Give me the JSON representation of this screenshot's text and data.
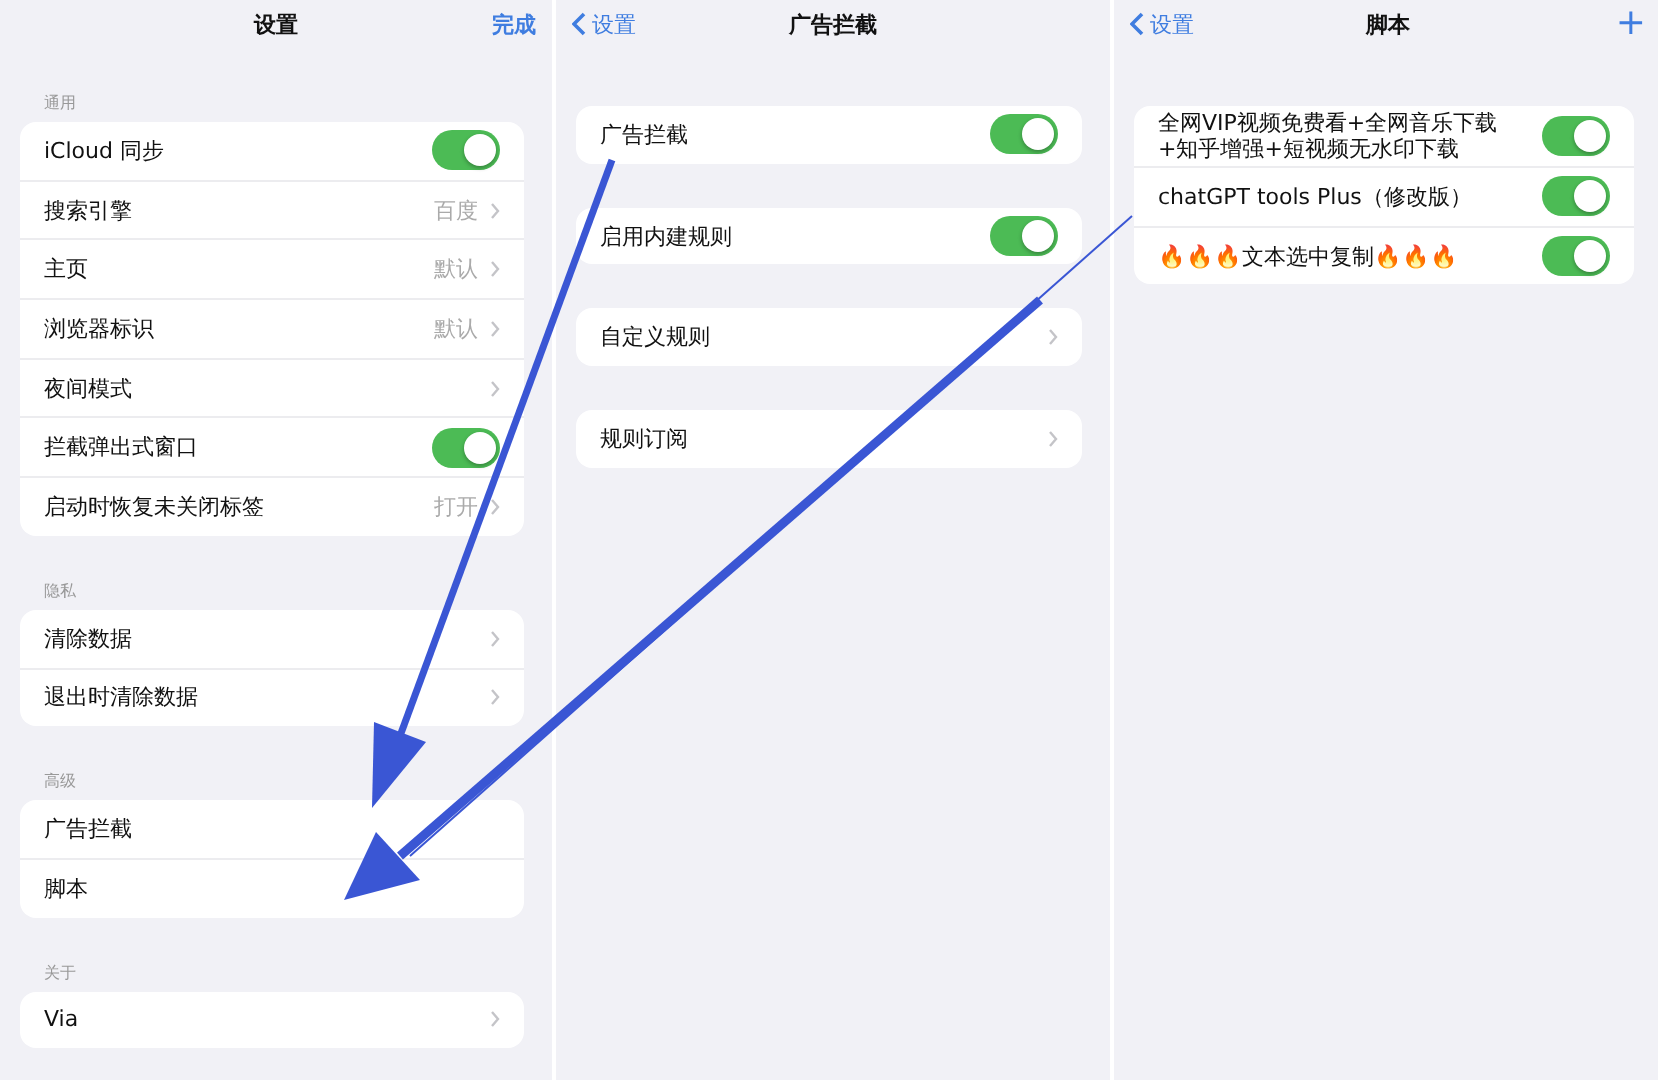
{
  "panels": [
    {
      "title": "设置",
      "done": "完成",
      "sections": [
        {
          "header": "通用",
          "grouped": true,
          "rows": [
            {
              "kind": "toggle",
              "label": "iCloud 同步",
              "on": true
            },
            {
              "kind": "link",
              "label": "搜索引擎",
              "value": "百度",
              "chevron": true
            },
            {
              "kind": "link",
              "label": "主页",
              "value": "默认",
              "chevron": true
            },
            {
              "kind": "link",
              "label": "浏览器标识",
              "value": "默认",
              "chevron": true
            },
            {
              "kind": "link",
              "label": "夜间模式",
              "chevron": true
            },
            {
              "kind": "toggle",
              "label": "拦截弹出式窗口",
              "on": true
            },
            {
              "kind": "link",
              "label": "启动时恢复未关闭标签",
              "value": "打开",
              "chevron": true
            }
          ]
        },
        {
          "header": "隐私",
          "grouped": true,
          "rows": [
            {
              "kind": "link",
              "label": "清除数据",
              "chevron": true
            },
            {
              "kind": "link",
              "label": "退出时清除数据",
              "chevron": true
            }
          ]
        },
        {
          "header": "高级",
          "grouped": true,
          "rows": [
            {
              "kind": "link",
              "label": "广告拦截",
              "chevron": false
            },
            {
              "kind": "link",
              "label": "脚本",
              "chevron": false
            }
          ]
        },
        {
          "header": "关于",
          "grouped": true,
          "rows": [
            {
              "kind": "link",
              "label": "Via",
              "chevron": true
            }
          ]
        }
      ]
    },
    {
      "back": "设置",
      "title": "广告拦截",
      "sections": [
        {
          "grouped": false,
          "rows": [
            {
              "kind": "toggle",
              "label": "广告拦截",
              "on": true
            },
            {
              "kind": "toggle",
              "label": "启用内建规则",
              "on": true
            },
            {
              "kind": "link",
              "label": "自定义规则",
              "chevron": true
            },
            {
              "kind": "link",
              "label": "规则订阅",
              "chevron": true
            }
          ]
        }
      ]
    },
    {
      "back": "设置",
      "title": "脚本",
      "add": "+",
      "sections": [
        {
          "grouped": true,
          "rows": [
            {
              "kind": "toggle",
              "label": "全网VIP视频免费看+全网音乐下载+知乎增强+短视频无水印下载",
              "on": true
            },
            {
              "kind": "toggle",
              "label": "chatGPT tools Plus（修改版）",
              "on": true
            },
            {
              "kind": "toggle",
              "label": "🔥🔥🔥文本选中复制🔥🔥🔥",
              "on": true
            }
          ]
        }
      ]
    }
  ]
}
